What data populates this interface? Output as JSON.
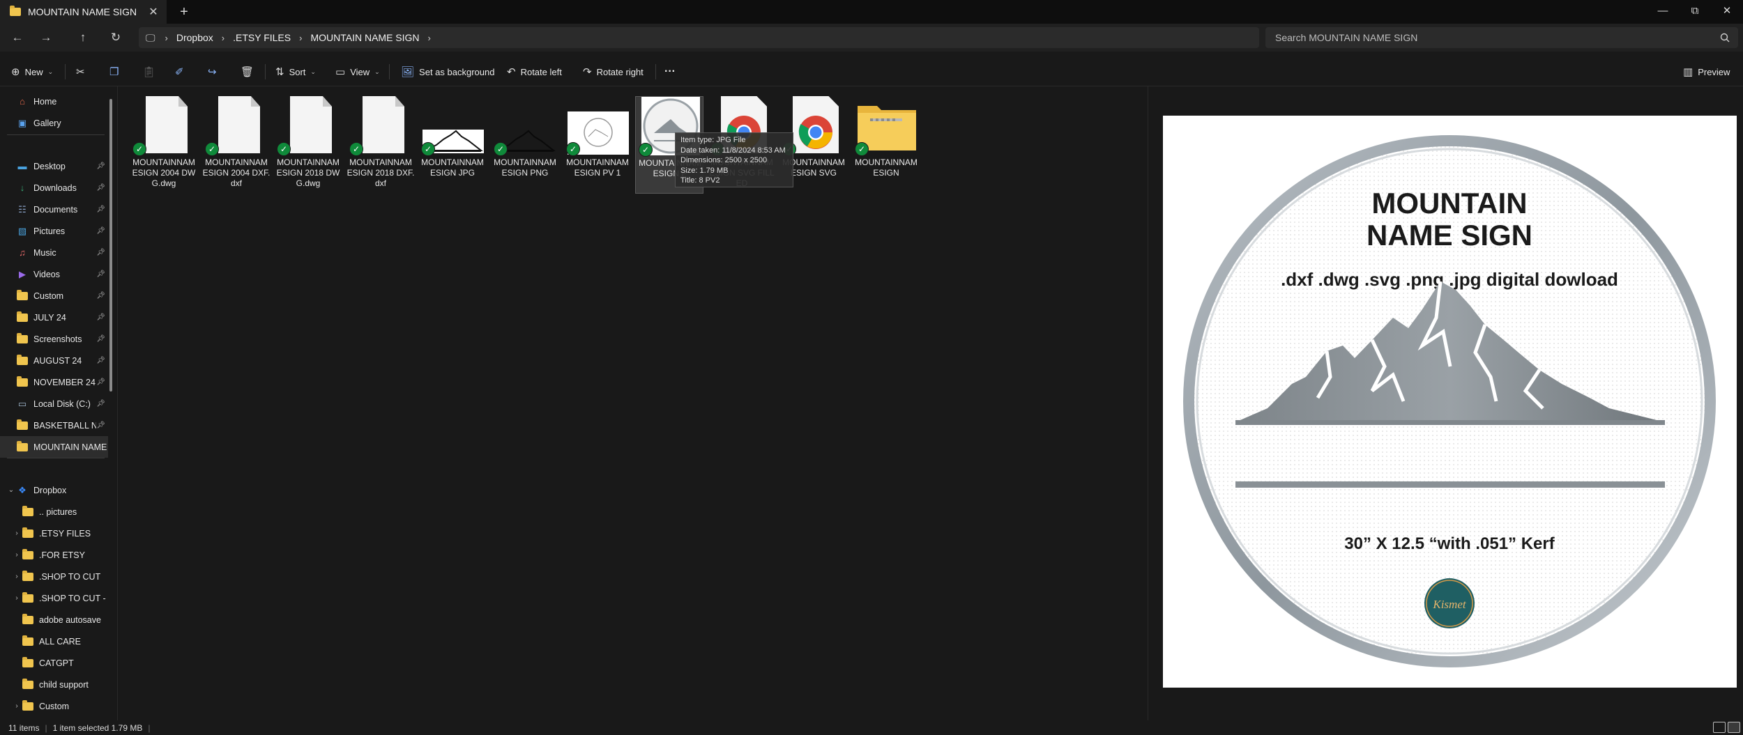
{
  "window": {
    "tab_title": "MOUNTAIN NAME SIGN",
    "tab_close": "✕",
    "new_tab": "+"
  },
  "address": {
    "breadcrumbs": [
      "Dropbox",
      ".ETSY FILES",
      "MOUNTAIN NAME SIGN"
    ],
    "search_placeholder": "Search MOUNTAIN NAME SIGN"
  },
  "toolbar": {
    "new_label": "New",
    "sort_label": "Sort",
    "view_label": "View",
    "set_background_label": "Set as background",
    "rotate_left_label": "Rotate left",
    "rotate_right_label": "Rotate right",
    "more_label": "···",
    "preview_label": "Preview"
  },
  "sidebar": {
    "items": [
      {
        "label": "Home"
      },
      {
        "label": "Gallery"
      },
      {
        "label": "Desktop"
      },
      {
        "label": "Downloads"
      },
      {
        "label": "Documents"
      },
      {
        "label": "Pictures"
      },
      {
        "label": "Music"
      },
      {
        "label": "Videos"
      },
      {
        "label": "Custom"
      },
      {
        "label": "JULY 24"
      },
      {
        "label": "Screenshots"
      },
      {
        "label": "AUGUST 24"
      },
      {
        "label": "NOVEMBER 24"
      },
      {
        "label": "Local Disk (C:)"
      },
      {
        "label": "BASKETBALL NI"
      },
      {
        "label": "MOUNTAIN NAME"
      },
      {
        "label": "Dropbox"
      },
      {
        "label": ".. pictures"
      },
      {
        "label": ".ETSY FILES"
      },
      {
        "label": ".FOR ETSY"
      },
      {
        "label": ".SHOP TO CUT"
      },
      {
        "label": ".SHOP TO CUT - ("
      },
      {
        "label": "adobe autosave"
      },
      {
        "label": "ALL CARE"
      },
      {
        "label": "CATGPT"
      },
      {
        "label": "child support"
      },
      {
        "label": "Custom"
      }
    ]
  },
  "files": [
    {
      "name": "MOUNTAINNAM ESIGN 2004 DWG.dwg",
      "kind": "doc"
    },
    {
      "name": "MOUNTAINNAM ESIGN 2004 DXF.dxf",
      "kind": "doc"
    },
    {
      "name": "MOUNTAINNAM ESIGN 2018 DWG.dwg",
      "kind": "doc"
    },
    {
      "name": "MOUNTAINNAM ESIGN 2018 DXF.dxf",
      "kind": "doc"
    },
    {
      "name": "MOUNTAINNAM ESIGN JPG",
      "kind": "mountain-img"
    },
    {
      "name": "MOUNTAINNAM ESIGN PNG",
      "kind": "mountain-png"
    },
    {
      "name": "MOUNTAINNAM ESIGN PV 1",
      "kind": "sign-small"
    },
    {
      "name": "MOUNTAINNAM ESIGN P",
      "kind": "sign-round"
    },
    {
      "name": "MOUNTAINNAM ESIGN SVG FILLED",
      "kind": "chrome"
    },
    {
      "name": "MOUNTAINNAM ESIGN SVG",
      "kind": "chrome"
    },
    {
      "name": "MOUNTAINNAM ESIGN",
      "kind": "zip"
    }
  ],
  "tooltip": {
    "line1": "Item type: JPG File",
    "line2": "Date taken: 11/8/2024 8:53 AM",
    "line3": "Dimensions: 2500 x 2500",
    "line4": "Size: 1.79 MB",
    "line5": "Title: 8 PV2"
  },
  "preview": {
    "title_line1": "MOUNTAIN",
    "title_line2": "NAME SIGN",
    "formats": ".dxf .dwg .svg .png .jpg digital dowload",
    "size_text": "30” X 12.5 “with .051” Kerf",
    "logo_text": "Kismet"
  },
  "status": {
    "item_count": "11 items",
    "selection": "1 item selected  1.79 MB"
  },
  "colors": {
    "accent": "#8ab4f8",
    "folder": "#f0c54e",
    "sync_check": "#0f8a3a",
    "logo_teal": "#1f5f63"
  }
}
